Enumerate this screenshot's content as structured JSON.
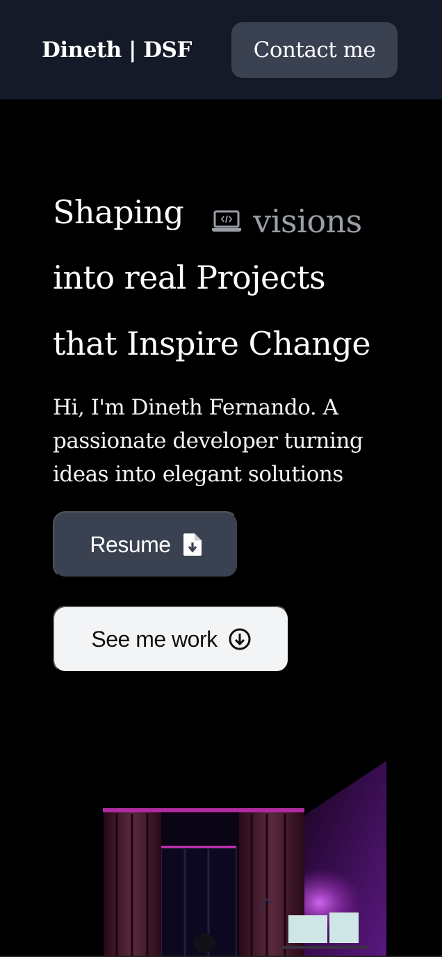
{
  "header": {
    "brand": "Dineth | DSF",
    "contact_label": "Contact me"
  },
  "hero": {
    "line1": "Shaping",
    "rotating_word": "visions",
    "line2": "into real Projects",
    "line3": "that Inspire Change",
    "intro": "Hi, I'm Dineth Fernando. A passionate developer turning ideas into elegant solutions"
  },
  "buttons": {
    "resume_label": "Resume",
    "work_label": "See me work"
  },
  "colors": {
    "nav_bg": "#141a27",
    "button_dark": "#3a4150",
    "button_light": "#f3f4f6",
    "accent_purple": "#a020c0"
  },
  "icons": {
    "rotating_icon": "laptop-code-icon",
    "resume_icon": "file-download-icon",
    "work_icon": "circle-arrow-down-icon"
  }
}
